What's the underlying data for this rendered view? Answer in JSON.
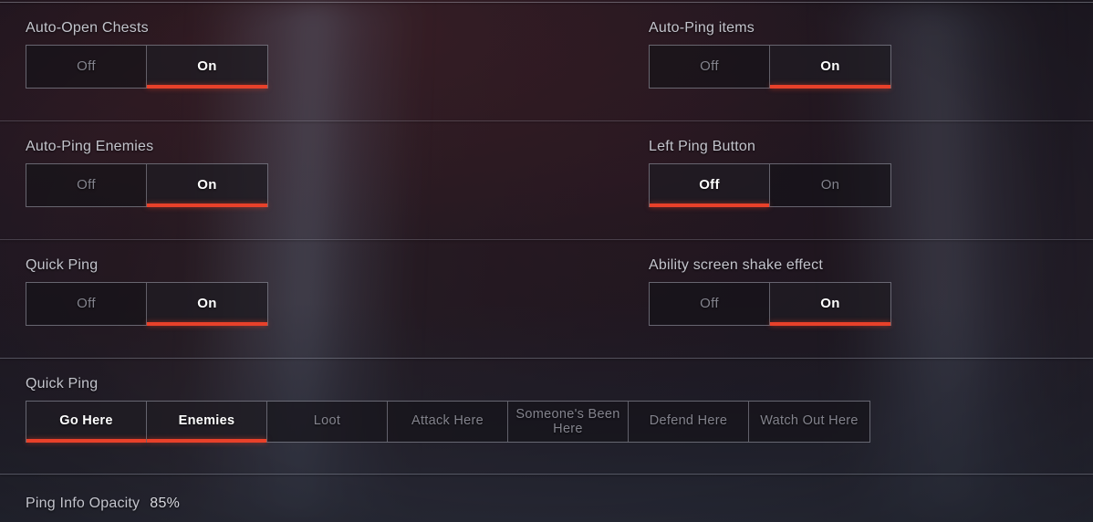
{
  "accent_color": "#e8412a",
  "label_color": "#c3c4cc",
  "selected_text_color": "#ffffff",
  "unselected_text_color": "#83838d",
  "settings": [
    {
      "label": "Auto-Open Chests",
      "options": [
        "Off",
        "On"
      ],
      "selected": "On"
    },
    {
      "label": "Auto-Ping items",
      "options": [
        "Off",
        "On"
      ],
      "selected": "On"
    },
    {
      "label": "Auto-Ping Enemies",
      "options": [
        "Off",
        "On"
      ],
      "selected": "On"
    },
    {
      "label": "Left Ping Button",
      "options": [
        "Off",
        "On"
      ],
      "selected": "Off"
    },
    {
      "label": "Quick Ping",
      "options": [
        "Off",
        "On"
      ],
      "selected": "On"
    },
    {
      "label": "Ability screen shake effect",
      "options": [
        "Off",
        "On"
      ],
      "selected": "On"
    }
  ],
  "quick_ping": {
    "label": "Quick Ping",
    "options": [
      "Go Here",
      "Enemies",
      "Loot",
      "Attack Here",
      "Someone's Been Here",
      "Defend Here",
      "Watch Out Here"
    ],
    "selected": [
      "Go Here",
      "Enemies"
    ]
  },
  "ping_info_opacity": {
    "label": "Ping Info Opacity",
    "value": "85%"
  }
}
